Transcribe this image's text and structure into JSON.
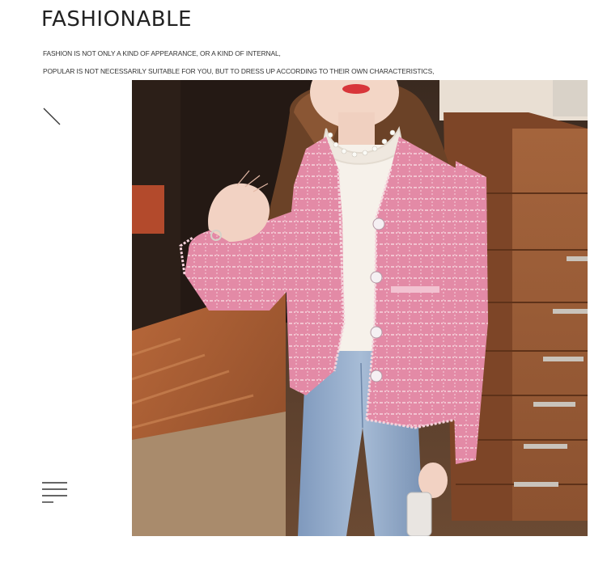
{
  "heading": {
    "title": "FASHIONABLE",
    "line1": "FASHION IS NOT ONLY A KIND OF APPEARANCE, OR A KIND OF INTERNAL,",
    "line2": "POPULAR IS NOT NECESSARILY SUITABLE FOR YOU, BUT TO DRESS UP ACCORDING TO THEIR OWN CHARACTERISTICS,"
  },
  "icons": {
    "slash": "diagonal-line-icon",
    "menu": "menu-lines-icon"
  },
  "photo": {
    "subject": "model-pink-tweed-jacket-photo"
  },
  "colors": {
    "jacket": "#e58aa8",
    "blouse": "#f6f1ea",
    "jeans": "#8fa8c6",
    "wood": "#9b5a33",
    "background": "#ffffff"
  }
}
